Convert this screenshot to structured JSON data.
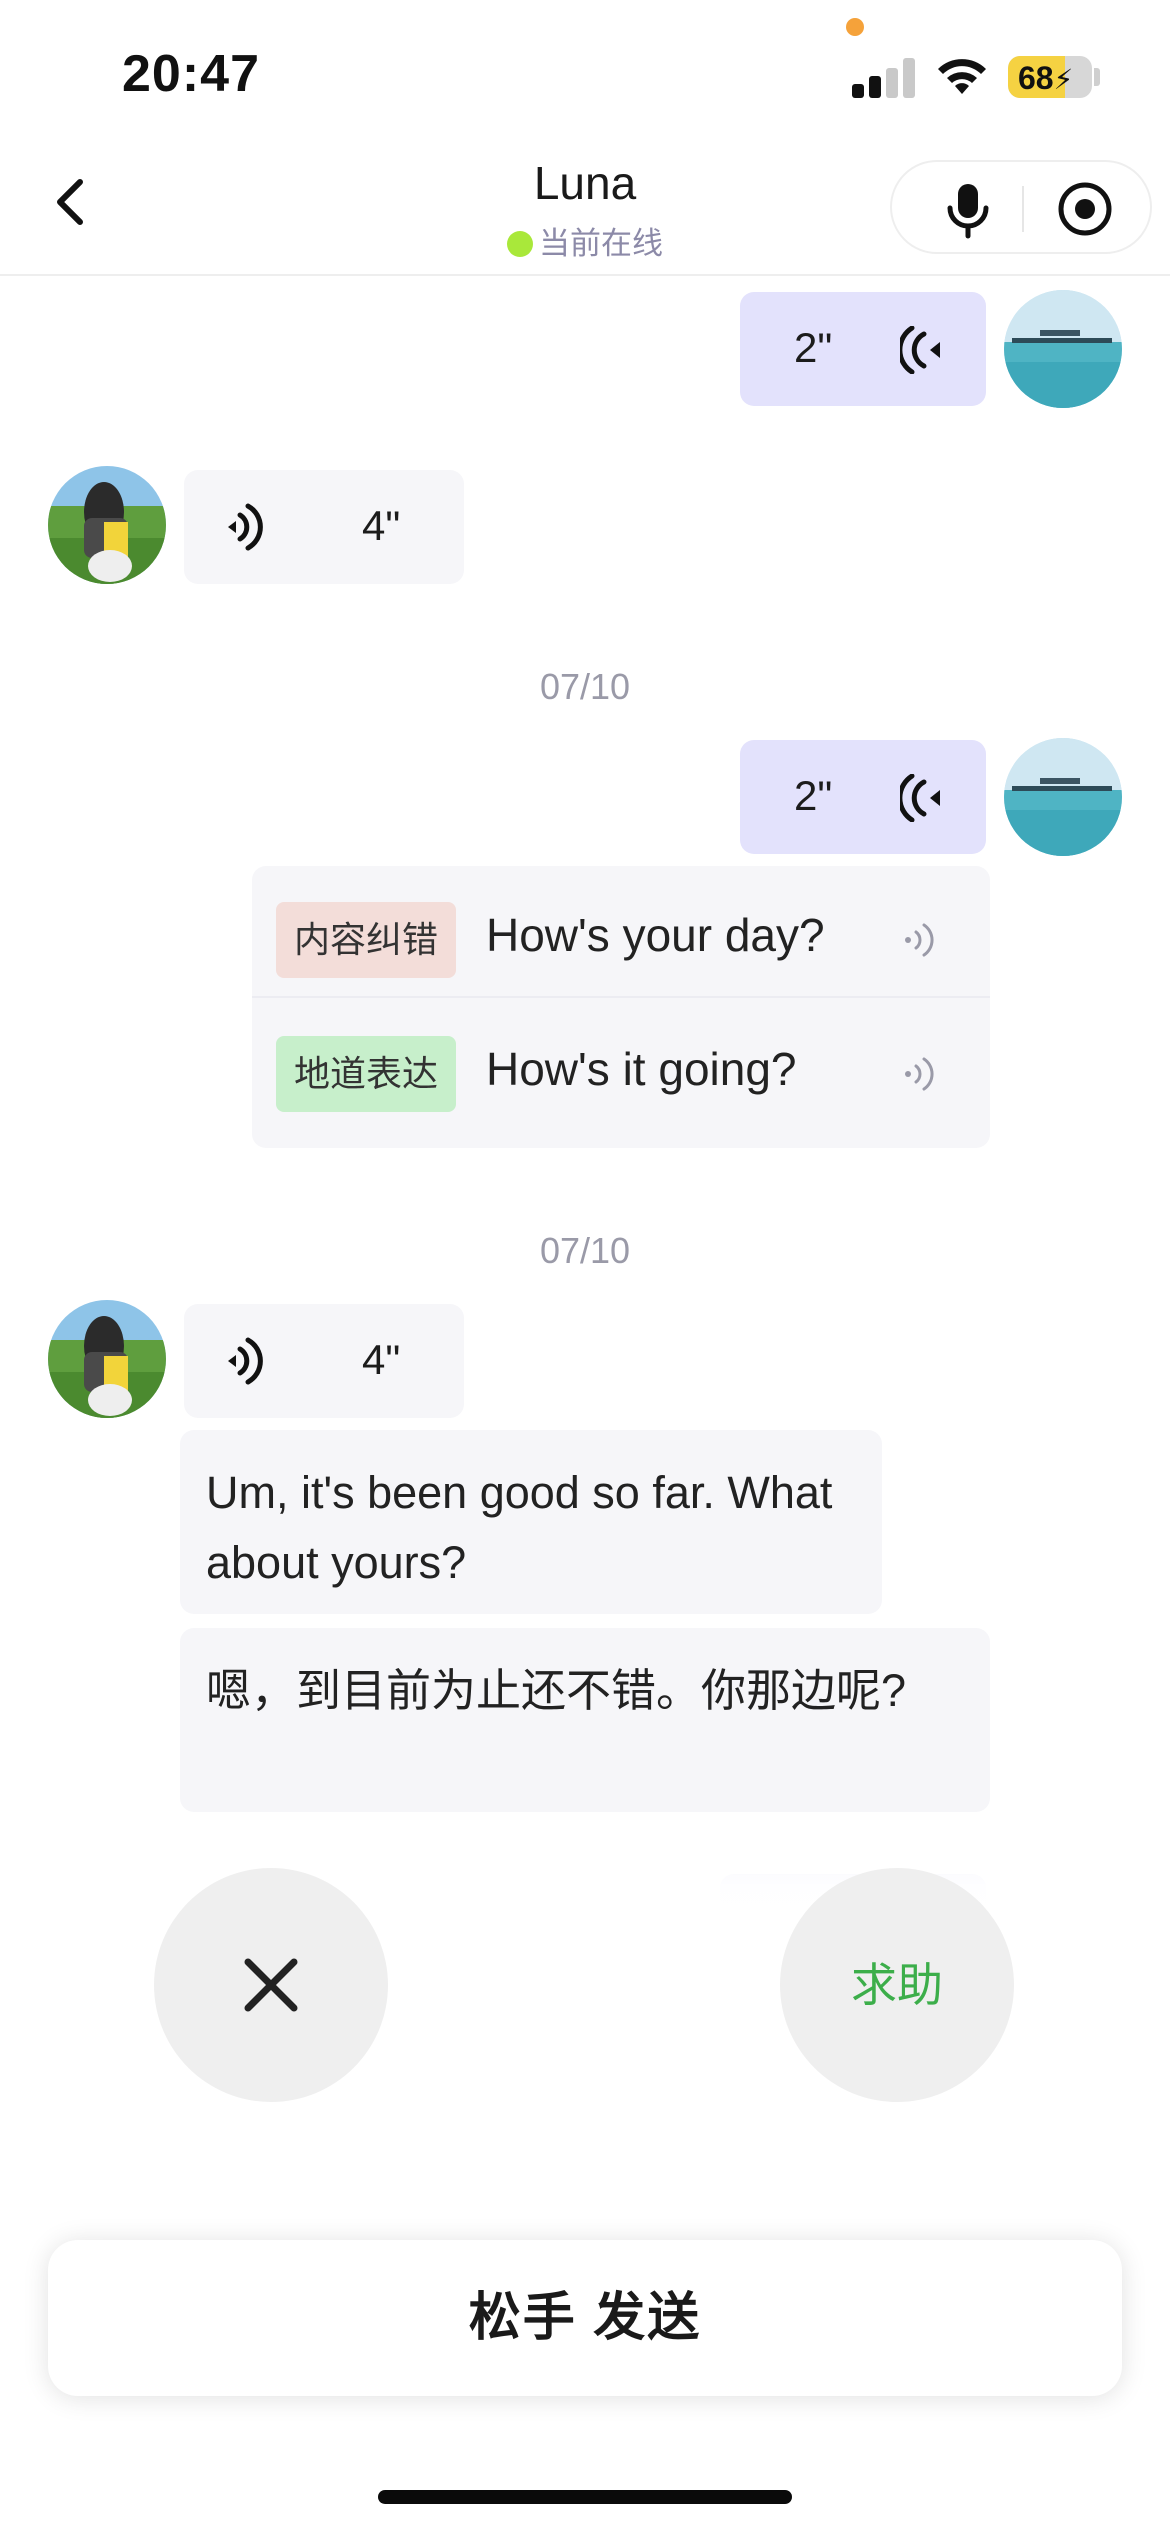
{
  "status_bar": {
    "time": "20:47",
    "battery": "68",
    "battery_level": 0.68,
    "icons": [
      "signal-icon",
      "wifi-icon",
      "battery-charging-icon"
    ]
  },
  "header": {
    "back_icon": "chevron-left-icon",
    "title": "Luna",
    "status": "当前在线",
    "status_color": "#a9e83a",
    "mic_icon": "microphone-icon",
    "record_icon": "record-icon"
  },
  "messages": {
    "m1": {
      "sender": "me",
      "type": "voice",
      "duration": "2\""
    },
    "m2": {
      "sender": "other",
      "type": "voice",
      "duration": "4\""
    },
    "date1": "07/10",
    "m3": {
      "sender": "me",
      "type": "voice",
      "duration": "2\""
    },
    "feedback": [
      {
        "tag": "内容纠错",
        "tag_color": "#f3ddd9",
        "text": "How's your day?"
      },
      {
        "tag": "地道表达",
        "tag_color": "#c7efcb",
        "text": "How's it going?"
      }
    ],
    "date2": "07/10",
    "m4": {
      "sender": "other",
      "type": "voice",
      "duration": "4\""
    },
    "transcript": "Um, it's been good so far. What about yours?",
    "translation": "嗯，到目前为止还不错。你那边呢?"
  },
  "controls": {
    "cancel_icon": "close-icon",
    "help_label": "求助",
    "help_color": "#3cae4a",
    "release_label": "松手 发送"
  },
  "colors": {
    "my_bubble": "#e3e2fc",
    "other_bubble": "#f6f6f9"
  }
}
